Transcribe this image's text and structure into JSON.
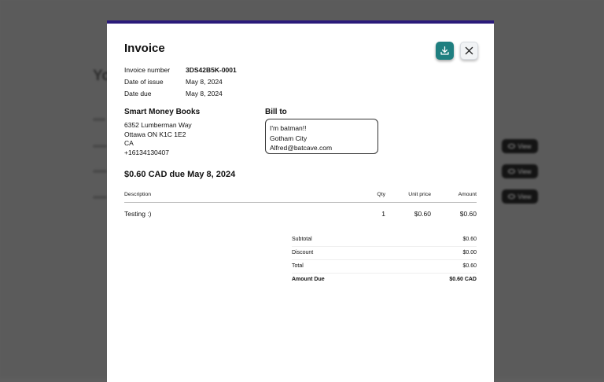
{
  "background": {
    "title": "Yo",
    "view_buttons": [
      "View",
      "View",
      "View"
    ]
  },
  "modal": {
    "title": "Invoice",
    "accent_color": "#2a1a7a",
    "download_button_icon": "download-icon",
    "close_button_icon": "close-icon",
    "meta": [
      {
        "label": "Invoice number",
        "value": "3DS42B5K-0001"
      },
      {
        "label": "Date of issue",
        "value": "May 8, 2024"
      },
      {
        "label": "Date due",
        "value": "May 8, 2024"
      }
    ],
    "seller": {
      "name": "Smart Money Books",
      "address_line1": "6352 Lumberman Way",
      "address_line2": "Ottawa ON K1C 1E2",
      "country": "CA",
      "phone": "+16134130407"
    },
    "bill_to": {
      "heading": "Bill to",
      "line1": "I'm batman!!",
      "line2": "Gotham City",
      "line3": "Alfred@batcave.com"
    },
    "amount_due_heading": "$0.60 CAD due May 8, 2024",
    "table": {
      "headers": {
        "description": "Description",
        "qty": "Qty",
        "unit_price": "Unit price",
        "amount": "Amount"
      },
      "rows": [
        {
          "description": "Testing :)",
          "qty": "1",
          "unit_price": "$0.60",
          "amount": "$0.60"
        }
      ]
    },
    "totals": [
      {
        "label": "Subtotal",
        "value": "$0.60"
      },
      {
        "label": "Discount",
        "value": "$0.00"
      },
      {
        "label": "Total",
        "value": "$0.60"
      },
      {
        "label": "Amount Due",
        "value": "$0.60 CAD"
      }
    ]
  }
}
